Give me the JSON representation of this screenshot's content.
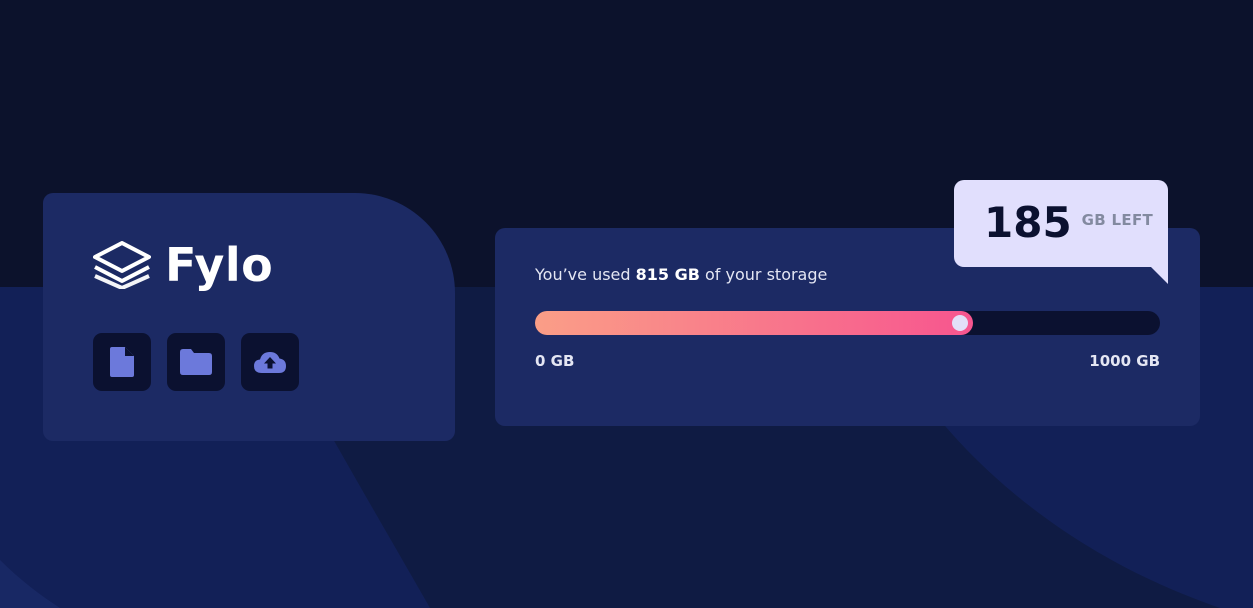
{
  "brand": {
    "name": "Fylo",
    "logo_icon": "stacked-layers-icon"
  },
  "toolbar": {
    "buttons": [
      {
        "icon": "document-icon",
        "label": "document"
      },
      {
        "icon": "folder-icon",
        "label": "folder"
      },
      {
        "icon": "cloud-upload-icon",
        "label": "upload"
      }
    ]
  },
  "storage": {
    "prefix": "You’ve used ",
    "used": "815 GB",
    "suffix": " of your storage",
    "used_gb": 815,
    "total_gb": 1000,
    "min_label": "0 GB",
    "max_label": "1000 GB",
    "remaining_value": "185",
    "remaining_unit": "GB LEFT"
  },
  "colors": {
    "background_dark": "#0c122c",
    "background_wave": "#0f1b43",
    "card": "#1c2a64",
    "icon_button_bg": "#0b1130",
    "icon_color": "#6c79db",
    "gradient_start": "#fa9e87",
    "gradient_end": "#f7558f",
    "callout_bg": "#e1dffd",
    "callout_value": "#0b1130",
    "callout_unit": "#838aa0"
  }
}
